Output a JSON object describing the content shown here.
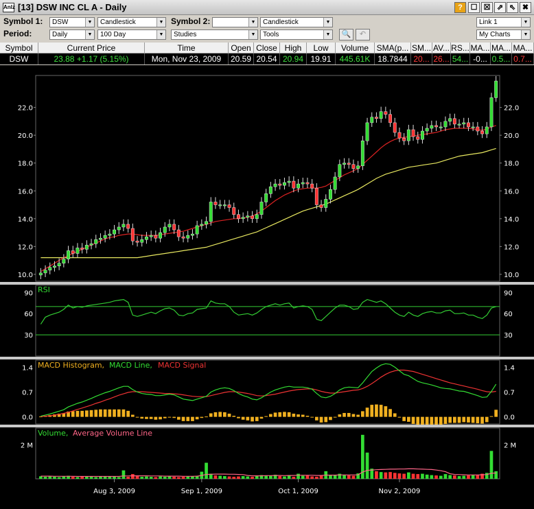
{
  "window": {
    "icon_label": "Anlz",
    "title": "[13] DSW INC CL A - Daily",
    "buttons": [
      "?",
      "☐",
      "☒",
      "⇗",
      "⇖",
      "✖"
    ]
  },
  "toolbar": {
    "symbol1_label": "Symbol 1:",
    "symbol1_value": "DSW",
    "chart_type1": "Candlestick",
    "symbol2_label": "Symbol 2:",
    "symbol2_value": "",
    "chart_type2": "Candlestick",
    "period_label": "Period:",
    "period_value": "Daily",
    "range_value": "100 Day",
    "studies_value": "Studies",
    "tools_value": "Tools",
    "link_value": "Link 1",
    "mycharts_value": "My Charts"
  },
  "quote": {
    "headers": [
      "Symbol",
      "Current Price",
      "Time",
      "Open",
      "Close",
      "High",
      "Low",
      "Volume",
      "SMA(p...",
      "SM...",
      "AV...",
      "RS...",
      "MA...",
      "MA...",
      "MA..."
    ],
    "row": {
      "symbol": "DSW",
      "current_price": "23.88 +1.17 (5.15%)",
      "time": "Mon, Nov 23, 2009",
      "open": "20.59",
      "close": "20.54",
      "high": "20.94",
      "low": "19.91",
      "volume": "445.61K",
      "sma": "18.7844",
      "sm": "20...",
      "av": "26...",
      "rs": "54...",
      "ma1": "-0...",
      "ma2": "0.5...",
      "ma3": "0.7..."
    }
  },
  "panels": {
    "rsi_label": "RSI",
    "macd_hist_label": "MACD Histogram,",
    "macd_line_label": "MACD Line,",
    "macd_signal_label": "MACD Signal",
    "volume_label": "Volume,",
    "avg_volume_label": "Average Volume Line"
  },
  "colors": {
    "up_candle": "#33dd33",
    "down_candle": "#ff3333",
    "sma_short": "#dd2222",
    "sma_long": "#e8e860",
    "rsi_line": "#33cc33",
    "macd_line": "#33dd33",
    "macd_signal": "#ee3333",
    "histogram": "#f0b020"
  },
  "chart_data": [
    {
      "type": "candlestick",
      "title": "DSW INC CL A - Daily",
      "ylim": [
        10.0,
        23.9
      ],
      "y_ticks": [
        "10.0",
        "12.0",
        "14.0",
        "16.0",
        "18.0",
        "20.0",
        "22.0"
      ],
      "x_ticks": [
        "Aug 3, 2009",
        "Sep 1, 2009",
        "Oct 1, 2009",
        "Nov 2, 2009"
      ],
      "close": [
        10.1,
        10.3,
        10.5,
        10.6,
        10.8,
        11.1,
        11.7,
        11.5,
        11.9,
        11.8,
        12.1,
        12.2,
        12.5,
        12.6,
        12.8,
        12.9,
        13.2,
        13.4,
        13.6,
        13.3,
        12.4,
        12.3,
        12.5,
        12.7,
        12.8,
        12.6,
        13.0,
        13.4,
        13.6,
        13.2,
        12.7,
        12.6,
        12.8,
        12.9,
        13.5,
        13.6,
        13.8,
        15.2,
        15.0,
        15.0,
        15.0,
        14.8,
        14.3,
        14.0,
        14.1,
        14.2,
        14.0,
        14.3,
        15.2,
        15.8,
        16.3,
        16.5,
        16.4,
        16.6,
        16.7,
        16.2,
        16.5,
        16.6,
        16.5,
        16.2,
        15.0,
        14.8,
        15.4,
        16.1,
        17.0,
        17.9,
        18.0,
        17.9,
        17.6,
        17.8,
        19.6,
        20.9,
        21.3,
        21.2,
        21.7,
        21.5,
        20.9,
        20.2,
        19.8,
        19.6,
        20.4,
        19.9,
        19.7,
        20.3,
        20.5,
        20.7,
        20.6,
        20.6,
        21.0,
        21.2,
        20.8,
        20.8,
        20.9,
        20.6,
        20.6,
        20.3,
        20.1,
        20.6,
        22.7,
        23.9
      ],
      "sma_short": [
        10.2,
        10.4,
        10.6,
        10.8,
        11.0,
        11.2,
        11.35,
        11.5,
        11.65,
        11.8,
        11.95,
        12.1,
        12.25,
        12.4,
        12.55,
        12.65,
        12.7,
        12.8,
        12.85,
        12.9,
        12.9,
        12.85,
        12.8,
        12.8,
        12.8,
        12.8,
        12.85,
        12.9,
        12.95,
        13.0,
        13.05,
        13.1,
        13.2,
        13.3,
        13.4,
        13.5,
        13.6,
        13.7,
        13.8,
        13.85,
        13.9,
        13.95,
        14.0,
        14.0,
        14.05,
        14.1,
        14.2,
        14.35,
        14.55,
        14.8,
        15.05,
        15.3,
        15.5,
        15.7,
        15.85,
        16.0,
        16.1,
        16.15,
        16.2,
        16.2,
        16.2,
        16.25,
        16.35,
        16.55,
        16.75,
        16.95,
        17.15,
        17.3,
        17.45,
        17.6,
        17.9,
        18.2,
        18.5,
        18.8,
        19.1,
        19.35,
        19.55,
        19.7,
        19.8,
        19.85,
        19.9,
        19.95,
        20.0,
        20.05,
        20.1,
        20.15,
        20.2,
        20.3,
        20.4,
        20.45,
        20.5,
        20.5,
        20.5,
        20.5,
        20.45,
        20.4,
        20.35,
        20.45,
        20.6,
        20.7
      ],
      "sma_long": [
        11.2,
        11.2,
        11.2,
        11.2,
        11.2,
        11.2,
        11.2,
        11.2,
        11.2,
        11.2,
        11.2,
        11.2,
        11.2,
        11.2,
        11.2,
        11.2,
        11.2,
        11.2,
        11.2,
        11.2,
        11.2,
        11.2,
        11.25,
        11.3,
        11.35,
        11.4,
        11.45,
        11.5,
        11.55,
        11.6,
        11.65,
        11.7,
        11.75,
        11.8,
        11.85,
        11.9,
        11.95,
        12.05,
        12.15,
        12.25,
        12.35,
        12.45,
        12.55,
        12.65,
        12.75,
        12.85,
        12.95,
        13.05,
        13.2,
        13.35,
        13.5,
        13.65,
        13.8,
        13.95,
        14.1,
        14.25,
        14.4,
        14.55,
        14.65,
        14.75,
        14.85,
        14.95,
        15.05,
        15.2,
        15.35,
        15.5,
        15.65,
        15.8,
        15.95,
        16.1,
        16.3,
        16.5,
        16.7,
        16.9,
        17.05,
        17.2,
        17.3,
        17.4,
        17.5,
        17.6,
        17.7,
        17.75,
        17.8,
        17.85,
        17.9,
        17.95,
        18.0,
        18.1,
        18.2,
        18.3,
        18.4,
        18.5,
        18.55,
        18.6,
        18.65,
        18.7,
        18.75,
        18.85,
        18.95,
        19.05
      ]
    },
    {
      "type": "line",
      "title": "RSI",
      "ylim": [
        0,
        100
      ],
      "y_ticks": [
        "30",
        "60",
        "90"
      ],
      "reference_lines": [
        30,
        70
      ],
      "values": [
        45,
        55,
        58,
        60,
        62,
        66,
        72,
        68,
        70,
        69,
        71,
        72,
        73,
        74,
        75,
        76,
        78,
        79,
        80,
        76,
        58,
        56,
        58,
        60,
        62,
        60,
        64,
        67,
        68,
        65,
        58,
        57,
        60,
        61,
        66,
        67,
        68,
        78,
        75,
        74,
        74,
        70,
        62,
        58,
        59,
        60,
        58,
        61,
        66,
        70,
        72,
        74,
        72,
        74,
        75,
        68,
        70,
        71,
        70,
        66,
        52,
        50,
        56,
        62,
        68,
        72,
        72,
        70,
        66,
        67,
        76,
        80,
        78,
        76,
        78,
        74,
        68,
        62,
        58,
        56,
        62,
        58,
        56,
        60,
        62,
        63,
        61,
        61,
        64,
        65,
        60,
        60,
        61,
        58,
        58,
        55,
        53,
        58,
        68,
        70
      ]
    },
    {
      "type": "line",
      "title": "MACD Histogram, MACD Line, MACD Signal",
      "ylim": [
        -0.2,
        1.6
      ],
      "y_ticks": [
        "0.0",
        "0.7",
        "1.4"
      ],
      "series": [
        {
          "name": "MACD Line",
          "values": [
            0.02,
            0.05,
            0.08,
            0.12,
            0.16,
            0.2,
            0.28,
            0.33,
            0.38,
            0.42,
            0.47,
            0.52,
            0.58,
            0.63,
            0.68,
            0.72,
            0.77,
            0.82,
            0.86,
            0.86,
            0.77,
            0.7,
            0.66,
            0.64,
            0.63,
            0.6,
            0.6,
            0.62,
            0.64,
            0.62,
            0.56,
            0.5,
            0.48,
            0.46,
            0.5,
            0.54,
            0.58,
            0.7,
            0.76,
            0.8,
            0.82,
            0.8,
            0.74,
            0.66,
            0.6,
            0.56,
            0.5,
            0.48,
            0.54,
            0.62,
            0.7,
            0.76,
            0.8,
            0.84,
            0.86,
            0.84,
            0.84,
            0.84,
            0.82,
            0.78,
            0.66,
            0.56,
            0.54,
            0.58,
            0.66,
            0.76,
            0.82,
            0.84,
            0.83,
            0.82,
            0.96,
            1.12,
            1.28,
            1.38,
            1.46,
            1.5,
            1.48,
            1.4,
            1.3,
            1.2,
            1.16,
            1.08,
            1.0,
            0.96,
            0.93,
            0.9,
            0.86,
            0.82,
            0.8,
            0.79,
            0.76,
            0.73,
            0.72,
            0.68,
            0.64,
            0.6,
            0.55,
            0.56,
            0.72,
            0.92
          ]
        },
        {
          "name": "MACD Signal",
          "values": [
            0.01,
            0.02,
            0.03,
            0.05,
            0.07,
            0.1,
            0.13,
            0.17,
            0.21,
            0.25,
            0.29,
            0.33,
            0.38,
            0.42,
            0.47,
            0.51,
            0.56,
            0.61,
            0.65,
            0.69,
            0.71,
            0.71,
            0.71,
            0.7,
            0.69,
            0.68,
            0.67,
            0.66,
            0.66,
            0.65,
            0.64,
            0.62,
            0.6,
            0.58,
            0.57,
            0.57,
            0.57,
            0.6,
            0.63,
            0.66,
            0.69,
            0.71,
            0.71,
            0.7,
            0.68,
            0.66,
            0.63,
            0.6,
            0.59,
            0.6,
            0.62,
            0.64,
            0.67,
            0.7,
            0.73,
            0.75,
            0.77,
            0.78,
            0.79,
            0.79,
            0.76,
            0.72,
            0.69,
            0.67,
            0.67,
            0.69,
            0.71,
            0.73,
            0.75,
            0.76,
            0.8,
            0.86,
            0.94,
            1.03,
            1.12,
            1.2,
            1.26,
            1.3,
            1.32,
            1.32,
            1.3,
            1.28,
            1.24,
            1.2,
            1.16,
            1.12,
            1.08,
            1.04,
            1.0,
            0.96,
            0.93,
            0.9,
            0.87,
            0.84,
            0.81,
            0.78,
            0.74,
            0.71,
            0.7,
            0.72
          ]
        },
        {
          "name": "MACD Histogram",
          "values": [
            0.01,
            0.03,
            0.05,
            0.07,
            0.09,
            0.1,
            0.15,
            0.16,
            0.17,
            0.17,
            0.18,
            0.19,
            0.2,
            0.21,
            0.21,
            0.21,
            0.21,
            0.21,
            0.21,
            0.17,
            0.06,
            -0.01,
            -0.05,
            -0.06,
            -0.06,
            -0.08,
            -0.07,
            -0.04,
            -0.02,
            -0.03,
            -0.08,
            -0.12,
            -0.12,
            -0.12,
            -0.07,
            -0.03,
            0.01,
            0.1,
            0.13,
            0.14,
            0.13,
            0.09,
            0.03,
            -0.04,
            -0.08,
            -0.1,
            -0.13,
            -0.12,
            -0.05,
            0.02,
            0.08,
            0.12,
            0.13,
            0.14,
            0.13,
            0.09,
            0.07,
            0.06,
            0.03,
            -0.01,
            -0.1,
            -0.16,
            -0.15,
            -0.09,
            -0.01,
            0.07,
            0.11,
            0.11,
            0.08,
            0.06,
            0.16,
            0.26,
            0.34,
            0.35,
            0.34,
            0.3,
            0.22,
            0.1,
            -0.02,
            -0.12,
            -0.14,
            -0.2,
            -0.24,
            -0.24,
            -0.23,
            -0.22,
            -0.22,
            -0.22,
            -0.2,
            -0.17,
            -0.17,
            -0.17,
            -0.15,
            -0.16,
            -0.17,
            -0.18,
            -0.19,
            -0.15,
            0.02,
            0.2
          ]
        }
      ]
    },
    {
      "type": "bar",
      "title": "Volume, Average Volume Line",
      "ylim": [
        0,
        3.0
      ],
      "y_ticks": [
        "2 M"
      ],
      "series": [
        {
          "name": "Volume",
          "values": [
            0.15,
            0.12,
            0.14,
            0.12,
            0.1,
            0.14,
            0.18,
            0.12,
            0.1,
            0.13,
            0.14,
            0.12,
            0.1,
            0.15,
            0.12,
            0.14,
            0.12,
            0.1,
            0.5,
            0.12,
            0.28,
            0.16,
            0.12,
            0.14,
            0.12,
            0.1,
            0.14,
            0.12,
            0.16,
            0.12,
            0.1,
            0.12,
            0.14,
            0.15,
            0.18,
            0.42,
            0.95,
            0.3,
            0.2,
            0.18,
            0.16,
            0.14,
            0.12,
            0.14,
            0.16,
            0.14,
            0.12,
            0.18,
            0.22,
            0.2,
            0.18,
            0.24,
            0.16,
            0.14,
            0.2,
            0.12,
            0.3,
            0.18,
            0.2,
            0.14,
            0.12,
            0.18,
            0.45,
            0.2,
            0.22,
            0.3,
            0.24,
            0.2,
            0.18,
            0.32,
            2.6,
            1.55,
            0.6,
            0.45,
            0.4,
            0.38,
            0.4,
            0.35,
            0.32,
            0.3,
            0.38,
            0.3,
            0.28,
            0.3,
            0.25,
            0.22,
            0.2,
            0.18,
            0.28,
            0.22,
            0.2,
            0.16,
            0.18,
            0.2,
            0.22,
            0.24,
            0.3,
            0.35,
            1.65,
            0.45
          ]
        },
        {
          "name": "Average Volume Line",
          "values": [
            0.16,
            0.16,
            0.16,
            0.15,
            0.15,
            0.15,
            0.15,
            0.15,
            0.14,
            0.14,
            0.14,
            0.14,
            0.14,
            0.14,
            0.14,
            0.14,
            0.14,
            0.14,
            0.17,
            0.17,
            0.18,
            0.18,
            0.18,
            0.18,
            0.17,
            0.17,
            0.17,
            0.16,
            0.16,
            0.16,
            0.16,
            0.15,
            0.15,
            0.15,
            0.16,
            0.2,
            0.26,
            0.27,
            0.28,
            0.28,
            0.28,
            0.27,
            0.27,
            0.26,
            0.25,
            0.2,
            0.18,
            0.18,
            0.18,
            0.19,
            0.19,
            0.2,
            0.2,
            0.19,
            0.2,
            0.2,
            0.21,
            0.21,
            0.21,
            0.21,
            0.2,
            0.2,
            0.22,
            0.22,
            0.22,
            0.23,
            0.23,
            0.23,
            0.23,
            0.23,
            0.4,
            0.5,
            0.52,
            0.54,
            0.55,
            0.56,
            0.57,
            0.57,
            0.58,
            0.58,
            0.59,
            0.59,
            0.58,
            0.57,
            0.56,
            0.55,
            0.52,
            0.48,
            0.42,
            0.3,
            0.26,
            0.25,
            0.24,
            0.23,
            0.23,
            0.23,
            0.24,
            0.25,
            0.33,
            0.34
          ]
        }
      ]
    }
  ]
}
